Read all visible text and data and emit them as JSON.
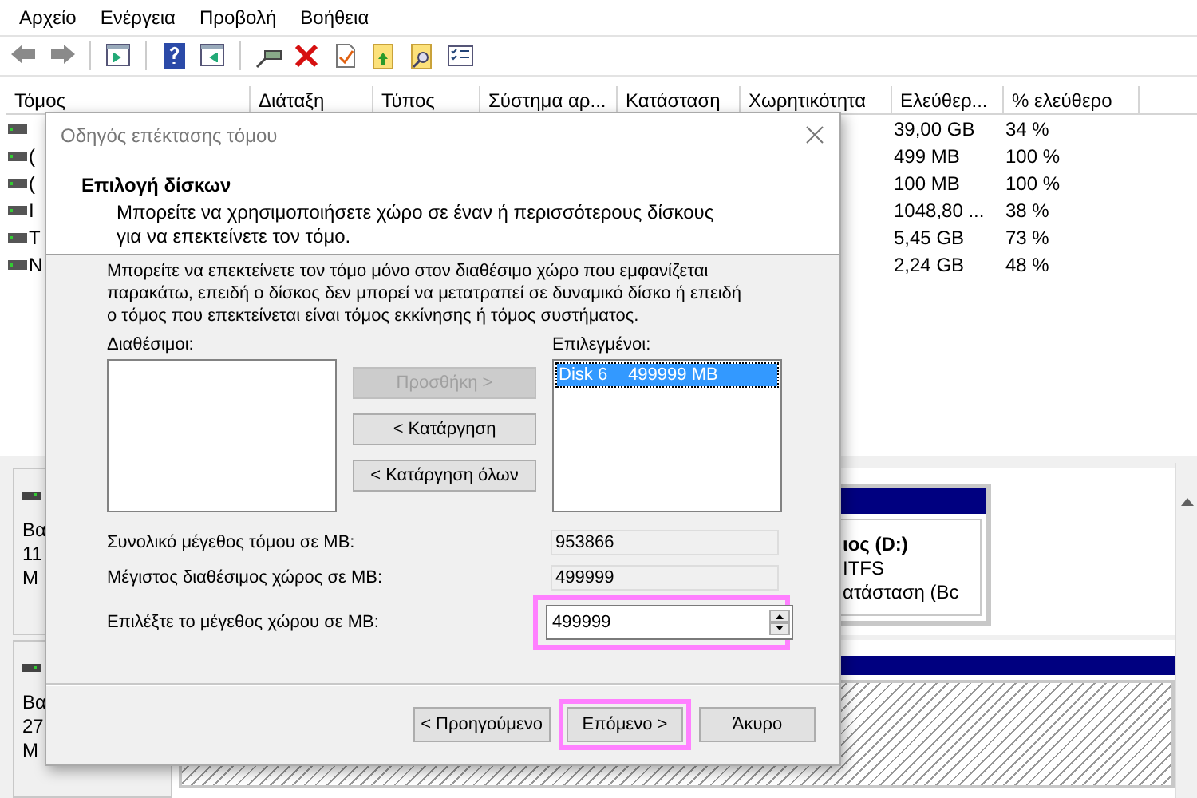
{
  "menu": [
    {
      "label": "Αρχείο"
    },
    {
      "label": "Ενέργεια"
    },
    {
      "label": "Προβολή"
    },
    {
      "label": "Βοήθεια"
    }
  ],
  "volume_table": {
    "columns": [
      "Τόμος",
      "Διάταξη",
      "Τύπος",
      "Σύστημα αρ...",
      "Κατάσταση",
      "Χωρητικότητα",
      "Ελεύθερ...",
      "% ελεύθερο"
    ],
    "rows": [
      {
        "free": "39,00 GB",
        "percent": "34 %"
      },
      {
        "name": "(",
        "free": "499 MB",
        "percent": "100 %"
      },
      {
        "name": "(",
        "free": "100 MB",
        "percent": "100 %"
      },
      {
        "name": "I",
        "free": "1048,80 ...",
        "percent": "38 %"
      },
      {
        "name": "T",
        "free": "5,45 GB",
        "percent": "73 %"
      },
      {
        "name": "N",
        "free": "2,24 GB",
        "percent": "48 %"
      }
    ]
  },
  "disk_panel": {
    "disks": [
      {
        "lines": [
          "Βα",
          "11",
          "Μ"
        ]
      },
      {
        "lines": [
          "Βα",
          "27",
          "Μ"
        ]
      }
    ],
    "volume": {
      "title": "ιος  (D:)",
      "lines": [
        "ITFS",
        "ατάσταση (Bc"
      ]
    }
  },
  "dialog": {
    "title": "Οδηγός επέκτασης τόμου",
    "heading": "Επιλογή δίσκων",
    "subtitle": "Μπορείτε να χρησιμοποιήσετε χώρο σε έναν ή περισσότερους δίσκους για να επεκτείνετε τον τόμο.",
    "note": "Μπορείτε να επεκτείνετε τον τόμο μόνο στον διαθέσιμο χώρο που εμφανίζεται παρακάτω, επειδή ο δίσκος δεν μπορεί να μετατραπεί σε δυναμικό δίσκο ή επειδή ο τόμος που επεκτείνεται είναι τόμος εκκίνησης ή τόμος συστήματος.",
    "available_label": "Διαθέσιμοι:",
    "selected_label": "Επιλεγμένοι:",
    "selected_items": [
      {
        "disk": "Disk 6",
        "size": "499999 MB",
        "selected": true
      }
    ],
    "move_buttons": [
      {
        "label": "Προσθήκη >",
        "disabled": true
      },
      {
        "label": "< Κατάργηση",
        "disabled": false
      },
      {
        "label": "< Κατάργηση όλων",
        "disabled": false
      }
    ],
    "fields": [
      {
        "kind": "readonly",
        "label": "Συνολικό μέγεθος τόμου σε MB:",
        "value": "953866",
        "highlighted": false
      },
      {
        "kind": "readonly",
        "label": "Μέγιστος διαθέσιμος χώρος σε MB:",
        "value": "499999",
        "highlighted": false
      },
      {
        "kind": "spin",
        "label": "Επιλέξτε το μέγεθος χώρου σε MB:",
        "value": "499999",
        "highlighted": true
      }
    ],
    "buttons": [
      {
        "label": "< Προηγούμενο",
        "highlighted": false
      },
      {
        "label": "Επόμενο >",
        "highlighted": true
      },
      {
        "label": "Άκυρο",
        "highlighted": false
      }
    ]
  }
}
